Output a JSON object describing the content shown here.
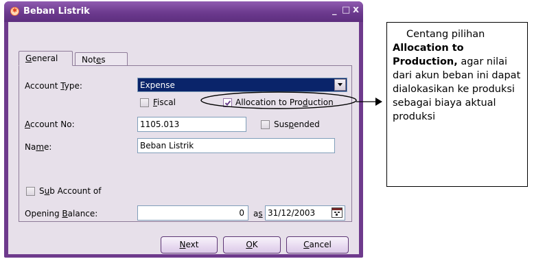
{
  "window": {
    "title": "Beban Listrik",
    "controls": {
      "minimize": "_",
      "maximize": "□",
      "close": "x"
    }
  },
  "tabs": [
    {
      "label_pre": "",
      "mnemonic": "G",
      "label_post": "eneral",
      "active": true
    },
    {
      "label_pre": "Not",
      "mnemonic": "e",
      "label_post": "s",
      "active": false
    }
  ],
  "form": {
    "account_type": {
      "label_pre": "Account ",
      "mnemonic": "T",
      "label_post": "ype:",
      "value": "Expense"
    },
    "fiscal": {
      "label_pre": "",
      "mnemonic": "F",
      "label_post": "iscal",
      "checked": false
    },
    "allocation": {
      "label_pre": "Allocation to Pro",
      "mnemonic": "d",
      "label_post": "uction",
      "checked": true
    },
    "account_no": {
      "label_pre": "",
      "mnemonic": "A",
      "label_post": "ccount No:",
      "value": "1105.013"
    },
    "suspended": {
      "label_pre": "Sus",
      "mnemonic": "p",
      "label_post": "ended",
      "checked": false
    },
    "name": {
      "label_pre": "Na",
      "mnemonic": "m",
      "label_post": "e:",
      "value": "Beban Listrik"
    },
    "sub_account": {
      "label_pre": "S",
      "mnemonic": "u",
      "label_post": "b Account of",
      "checked": false
    },
    "opening_balance": {
      "label_pre": "Opening ",
      "mnemonic": "B",
      "label_post": "alance:",
      "value": "0"
    },
    "as_of": {
      "label_pre": "a",
      "mnemonic": "s",
      "label_post": " of",
      "value": "31/12/2003"
    }
  },
  "buttons": {
    "next": {
      "mnemonic": "N",
      "label_post": "ext"
    },
    "ok": {
      "mnemonic": "O",
      "label_post": "K"
    },
    "cancel": {
      "mnemonic": "C",
      "label_post": "ancel"
    }
  },
  "callout": {
    "line1": "Centang pilihan",
    "bold": "Allocation to Production,",
    "rest": " agar nilai dari akun beban ini dapat dialokasikan ke produksi sebagai biaya aktual produksi"
  },
  "colors": {
    "window_frame": "#6e3a8c",
    "client": "#e7e0ea",
    "selection": "#0a246a",
    "check": "#6a3d8c"
  },
  "icons": {
    "app": "app-icon",
    "dropdown": "dropdown-arrow-icon",
    "calendar": "calendar-icon",
    "arrow": "arrow-right-icon"
  }
}
